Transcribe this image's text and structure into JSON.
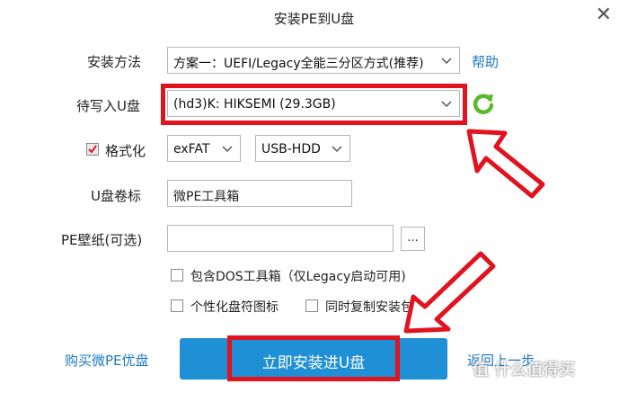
{
  "window": {
    "title": "安装PE到U盘"
  },
  "fields": {
    "install_method_label": "安装方法",
    "install_method_value": "方案一：UEFI/Legacy全能三分区方式(推荐)",
    "help_label": "帮助",
    "target_drive_label": "待写入U盘",
    "target_drive_value": "(hd3)K: HIKSEMI (29.3GB)",
    "format_label": "格式化",
    "format_checked": true,
    "filesystem_value": "exFAT",
    "boot_mode_value": "USB-HDD",
    "volume_label_label": "U盘卷标",
    "volume_label_value": "微PE工具箱",
    "wallpaper_label": "PE壁纸(可选)",
    "wallpaper_value": "",
    "browse_label": "...",
    "include_dos_label": "包含DOS工具箱（仅Legacy启动可用)",
    "custom_icon_label": "个性化盘符图标",
    "copy_installer_label": "同时复制安装包"
  },
  "footer": {
    "buy_link": "购买微PE优盘",
    "install_button": "立即安装进U盘",
    "back_link": "返回上一步"
  },
  "watermark": "值 什么值得买",
  "colors": {
    "accent": "#1f8fd6",
    "link": "#1a79c4",
    "annotation_red": "#e0131f",
    "refresh_green": "#5cb82e"
  }
}
